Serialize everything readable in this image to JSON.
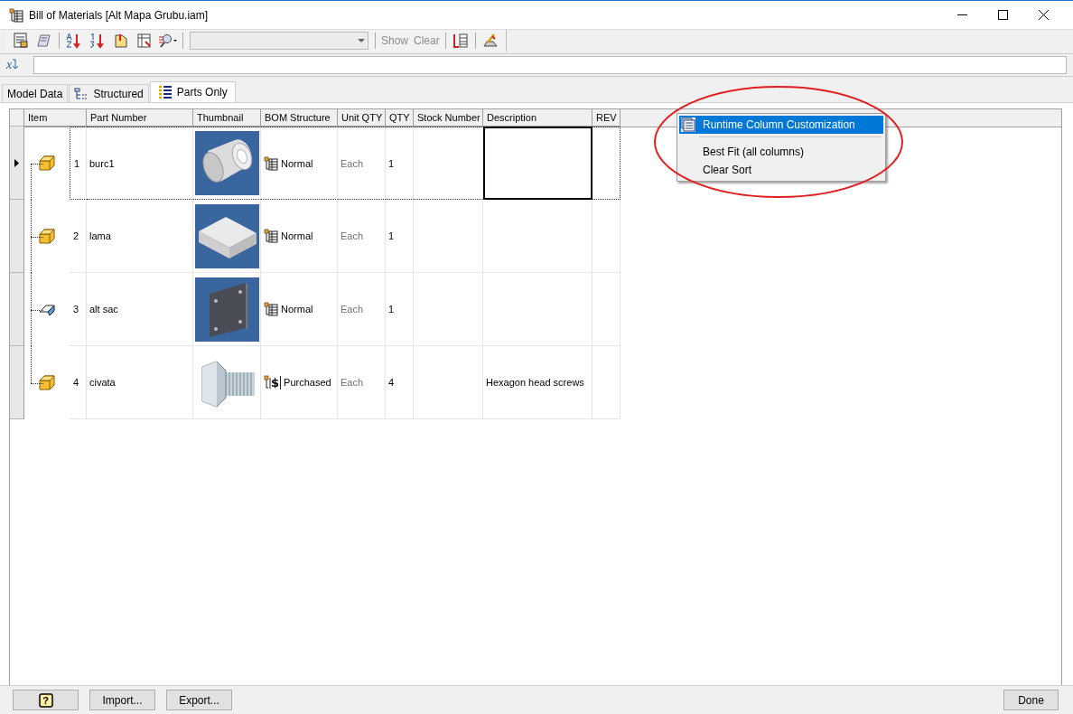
{
  "window": {
    "title": "Bill of Materials [Alt Mapa Grubu.iam]"
  },
  "toolbar": {
    "show": {
      "label": "Show",
      "disabled": true
    },
    "clear": {
      "label": "Clear",
      "disabled": true
    }
  },
  "formula_bar": {
    "symbol": "x"
  },
  "tabs": [
    {
      "label": "Model Data",
      "kind": "plain",
      "selected": false
    },
    {
      "label": "Structured",
      "kind": "structured",
      "selected": false
    },
    {
      "label": "Parts Only",
      "kind": "parts",
      "selected": true
    }
  ],
  "table": {
    "columns": [
      "Item",
      "Part Number",
      "Thumbnail",
      "BOM Structure",
      "Unit QTY",
      "QTY",
      "Stock Number",
      "Description",
      "REV"
    ],
    "rows": [
      {
        "item": "1",
        "part_number": "burc1",
        "kind": "part",
        "thumbnail": {
          "kind": "cylinder"
        },
        "bom_structure": {
          "label": "Normal",
          "kind": "normal"
        },
        "unit_qty": "Each",
        "qty": "1",
        "description_focused": true,
        "selected": true
      },
      {
        "item": "2",
        "part_number": "lama",
        "kind": "part",
        "thumbnail": {
          "kind": "block"
        },
        "bom_structure": {
          "label": "Normal",
          "kind": "normal"
        },
        "unit_qty": "Each",
        "qty": "1",
        "description_focused": false,
        "selected": false
      },
      {
        "item": "3",
        "part_number": "alt sac",
        "kind": "sheet-metal",
        "thumbnail": {
          "kind": "plate"
        },
        "bom_structure": {
          "label": "Normal",
          "kind": "normal"
        },
        "unit_qty": "Each",
        "qty": "1",
        "description_focused": false,
        "selected": false
      },
      {
        "item": "4",
        "part_number": "civata",
        "kind": "part",
        "thumbnail": {
          "kind": "bolt"
        },
        "bom_structure": {
          "label": "Purchased",
          "kind": "purchased",
          "symbol": "$"
        },
        "unit_qty": "Each",
        "qty": "4",
        "description": "Hexagon head screws",
        "description_focused": false,
        "selected": false
      }
    ]
  },
  "context_menu": {
    "items": [
      {
        "label": "Runtime Column Customization",
        "kind": "icon",
        "selected": true
      },
      {
        "label": "Best Fit (all columns)",
        "kind": "plain",
        "selected": false
      },
      {
        "label": "Clear Sort",
        "kind": "plain",
        "selected": false
      }
    ]
  },
  "footer": {
    "left_buttons": [
      {
        "kind": "help",
        "symbol": "?"
      },
      {
        "kind": "text",
        "label": "Import..."
      },
      {
        "kind": "text",
        "label": "Export..."
      }
    ],
    "right_buttons": [
      {
        "kind": "text",
        "label": "Done"
      }
    ]
  }
}
